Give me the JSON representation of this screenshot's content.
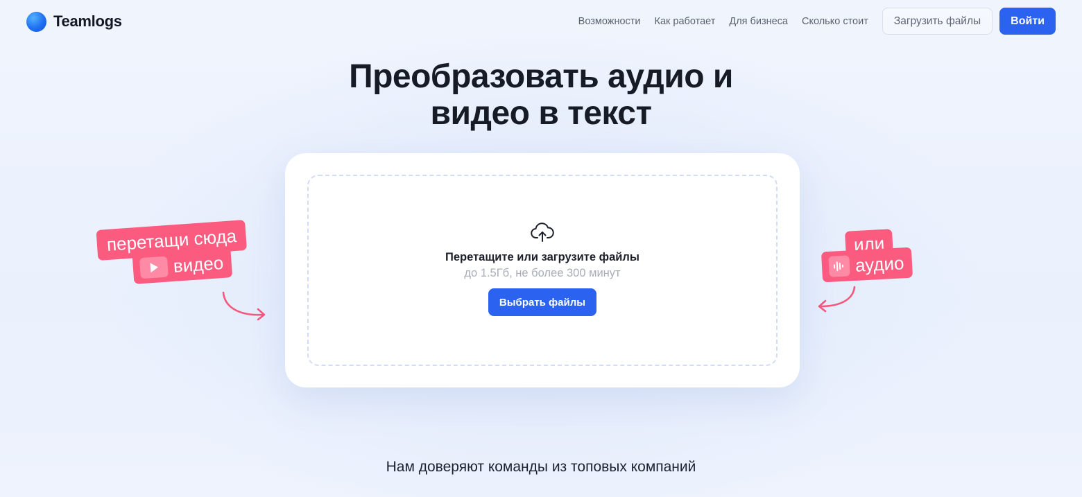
{
  "header": {
    "logo_text": "Teamlogs",
    "nav": [
      "Возможности",
      "Как работает",
      "Для бизнеса",
      "Сколько стоит"
    ],
    "upload_button": "Загрузить файлы",
    "login_button": "Войти"
  },
  "hero": {
    "title_line1": "Преобразовать аудио и",
    "title_line2": "видео в текст"
  },
  "upload": {
    "title": "Перетащите или загрузите файлы",
    "subtitle": "до 1.5Гб, не более 300 минут",
    "choose_button": "Выбрать файлы"
  },
  "stickers": {
    "left_line1": "перетащи сюда",
    "left_line2": "видео",
    "right_line1": "или",
    "right_line2": "аудио"
  },
  "trust_text": "Нам доверяют команды из топовых компаний",
  "colors": {
    "accent": "#2b63f0",
    "sticker": "#fc5b80",
    "background": "#eef3fd"
  },
  "icons": [
    "upload-cloud-icon",
    "play-icon",
    "audio-wave-icon",
    "curved-arrow-icon"
  ]
}
